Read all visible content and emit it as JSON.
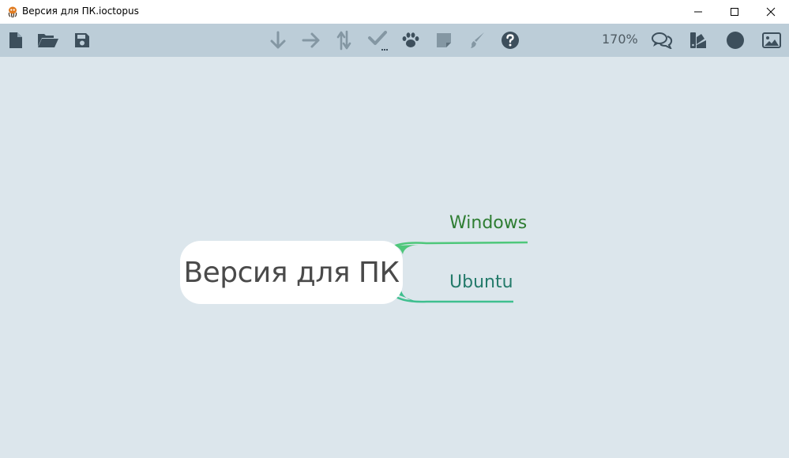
{
  "window": {
    "title": "Версия для ПК.ioctopus",
    "app_icon": "octopus-icon",
    "controls": [
      "minimize-icon",
      "maximize-icon",
      "close-icon"
    ]
  },
  "toolbar": {
    "left_icons": [
      "new-file-icon",
      "open-folder-icon",
      "save-icon"
    ],
    "center_icons": [
      "arrow-down-icon",
      "arrow-right-icon",
      "arrows-vertical-icon",
      "check-icon",
      "paw-icon",
      "sticky-note-icon",
      "paintbrush-icon",
      "help-icon"
    ],
    "zoom": "170%",
    "right_icons": [
      "comments-icon",
      "swatches-icon",
      "circle-icon",
      "image-icon"
    ]
  },
  "colors": {
    "background": "#dce6ec",
    "toolbar": "#bccdd8",
    "windows_branch": "#2e7d32",
    "ubuntu_branch": "#237a6a",
    "windows_line": "#4ec77a",
    "ubuntu_line": "#3fbf8f"
  },
  "mindmap": {
    "root": "Версия для ПК",
    "branches": [
      {
        "label": "Windows"
      },
      {
        "label": "Ubuntu"
      }
    ]
  }
}
